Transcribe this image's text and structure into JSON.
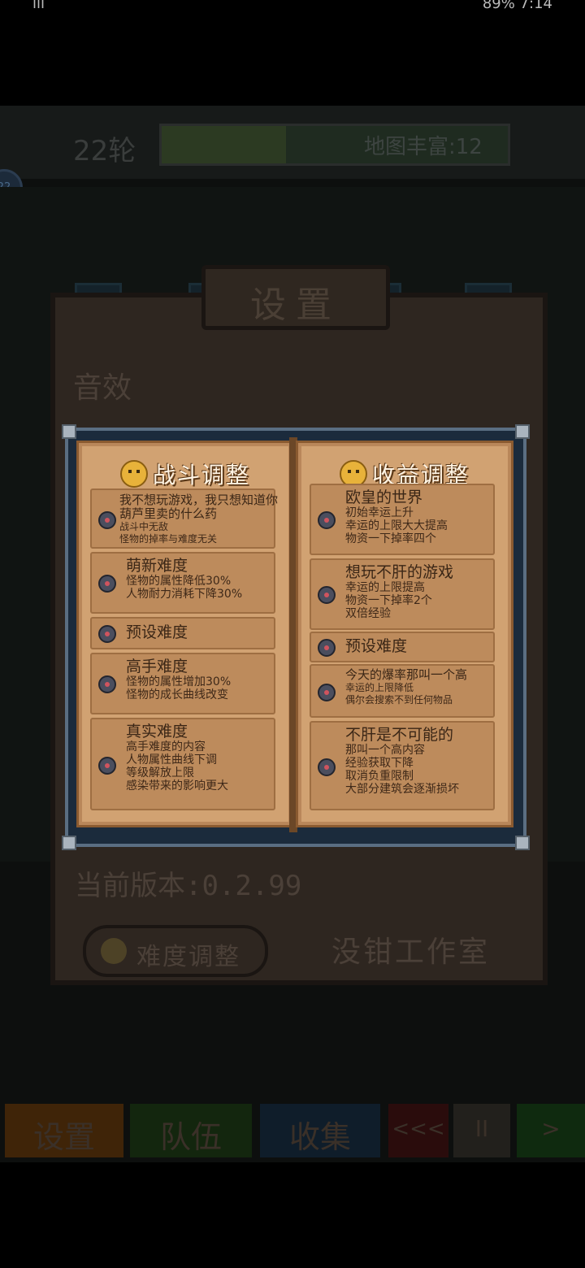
{
  "status": {
    "left": "ıll",
    "right": "89%  7:14"
  },
  "hud": {
    "round": "22轮",
    "richness": "地图丰富:12",
    "round_badge": "22"
  },
  "settings_panel": {
    "title": "设置",
    "sfx_label": "音效",
    "version": "当前版本:0.2.99",
    "difficulty_button": "难度调整",
    "studio": "没钳工作室"
  },
  "bottom_nav": {
    "settings": "设置",
    "team": "队伍",
    "collect": "收集",
    "back": "<<<",
    "pause": "II",
    "next": ">"
  },
  "book": {
    "left": {
      "title": "战斗调整",
      "options": [
        {
          "title": "我不想玩游戏，我只想知道你葫芦里卖的什么药",
          "lines": [
            "战斗中无敌",
            "怪物的掉率与难度无关"
          ]
        },
        {
          "title": "萌新难度",
          "lines": [
            "怪物的属性降低30%",
            "人物耐力消耗下降30%"
          ]
        },
        {
          "title": "预设难度",
          "lines": []
        },
        {
          "title": "高手难度",
          "lines": [
            "怪物的属性增加30%",
            "怪物的成长曲线改变"
          ]
        },
        {
          "title": "真实难度",
          "lines": [
            "高手难度的内容",
            "人物属性曲线下调",
            "等级解放上限",
            "感染带来的影响更大"
          ]
        }
      ]
    },
    "right": {
      "title": "收益调整",
      "options": [
        {
          "title": "欧皇的世界",
          "lines": [
            "初始幸运上升",
            "幸运的上限大大提高",
            "物资一下掉率四个"
          ]
        },
        {
          "title": "想玩不肝的游戏",
          "lines": [
            "幸运的上限提高",
            "物资一下掉率2个",
            "双倍经验"
          ]
        },
        {
          "title": "预设难度",
          "lines": []
        },
        {
          "title": "今天的爆率那叫一个高",
          "lines": [
            "幸运的上限降低",
            "偶尔会搜索不到任何物品"
          ]
        },
        {
          "title": "不肝是不可能的",
          "lines": [
            "那叫一个高内容",
            "经验获取下降",
            "取消负重限制",
            "大部分建筑会逐渐损坏"
          ]
        }
      ]
    }
  }
}
